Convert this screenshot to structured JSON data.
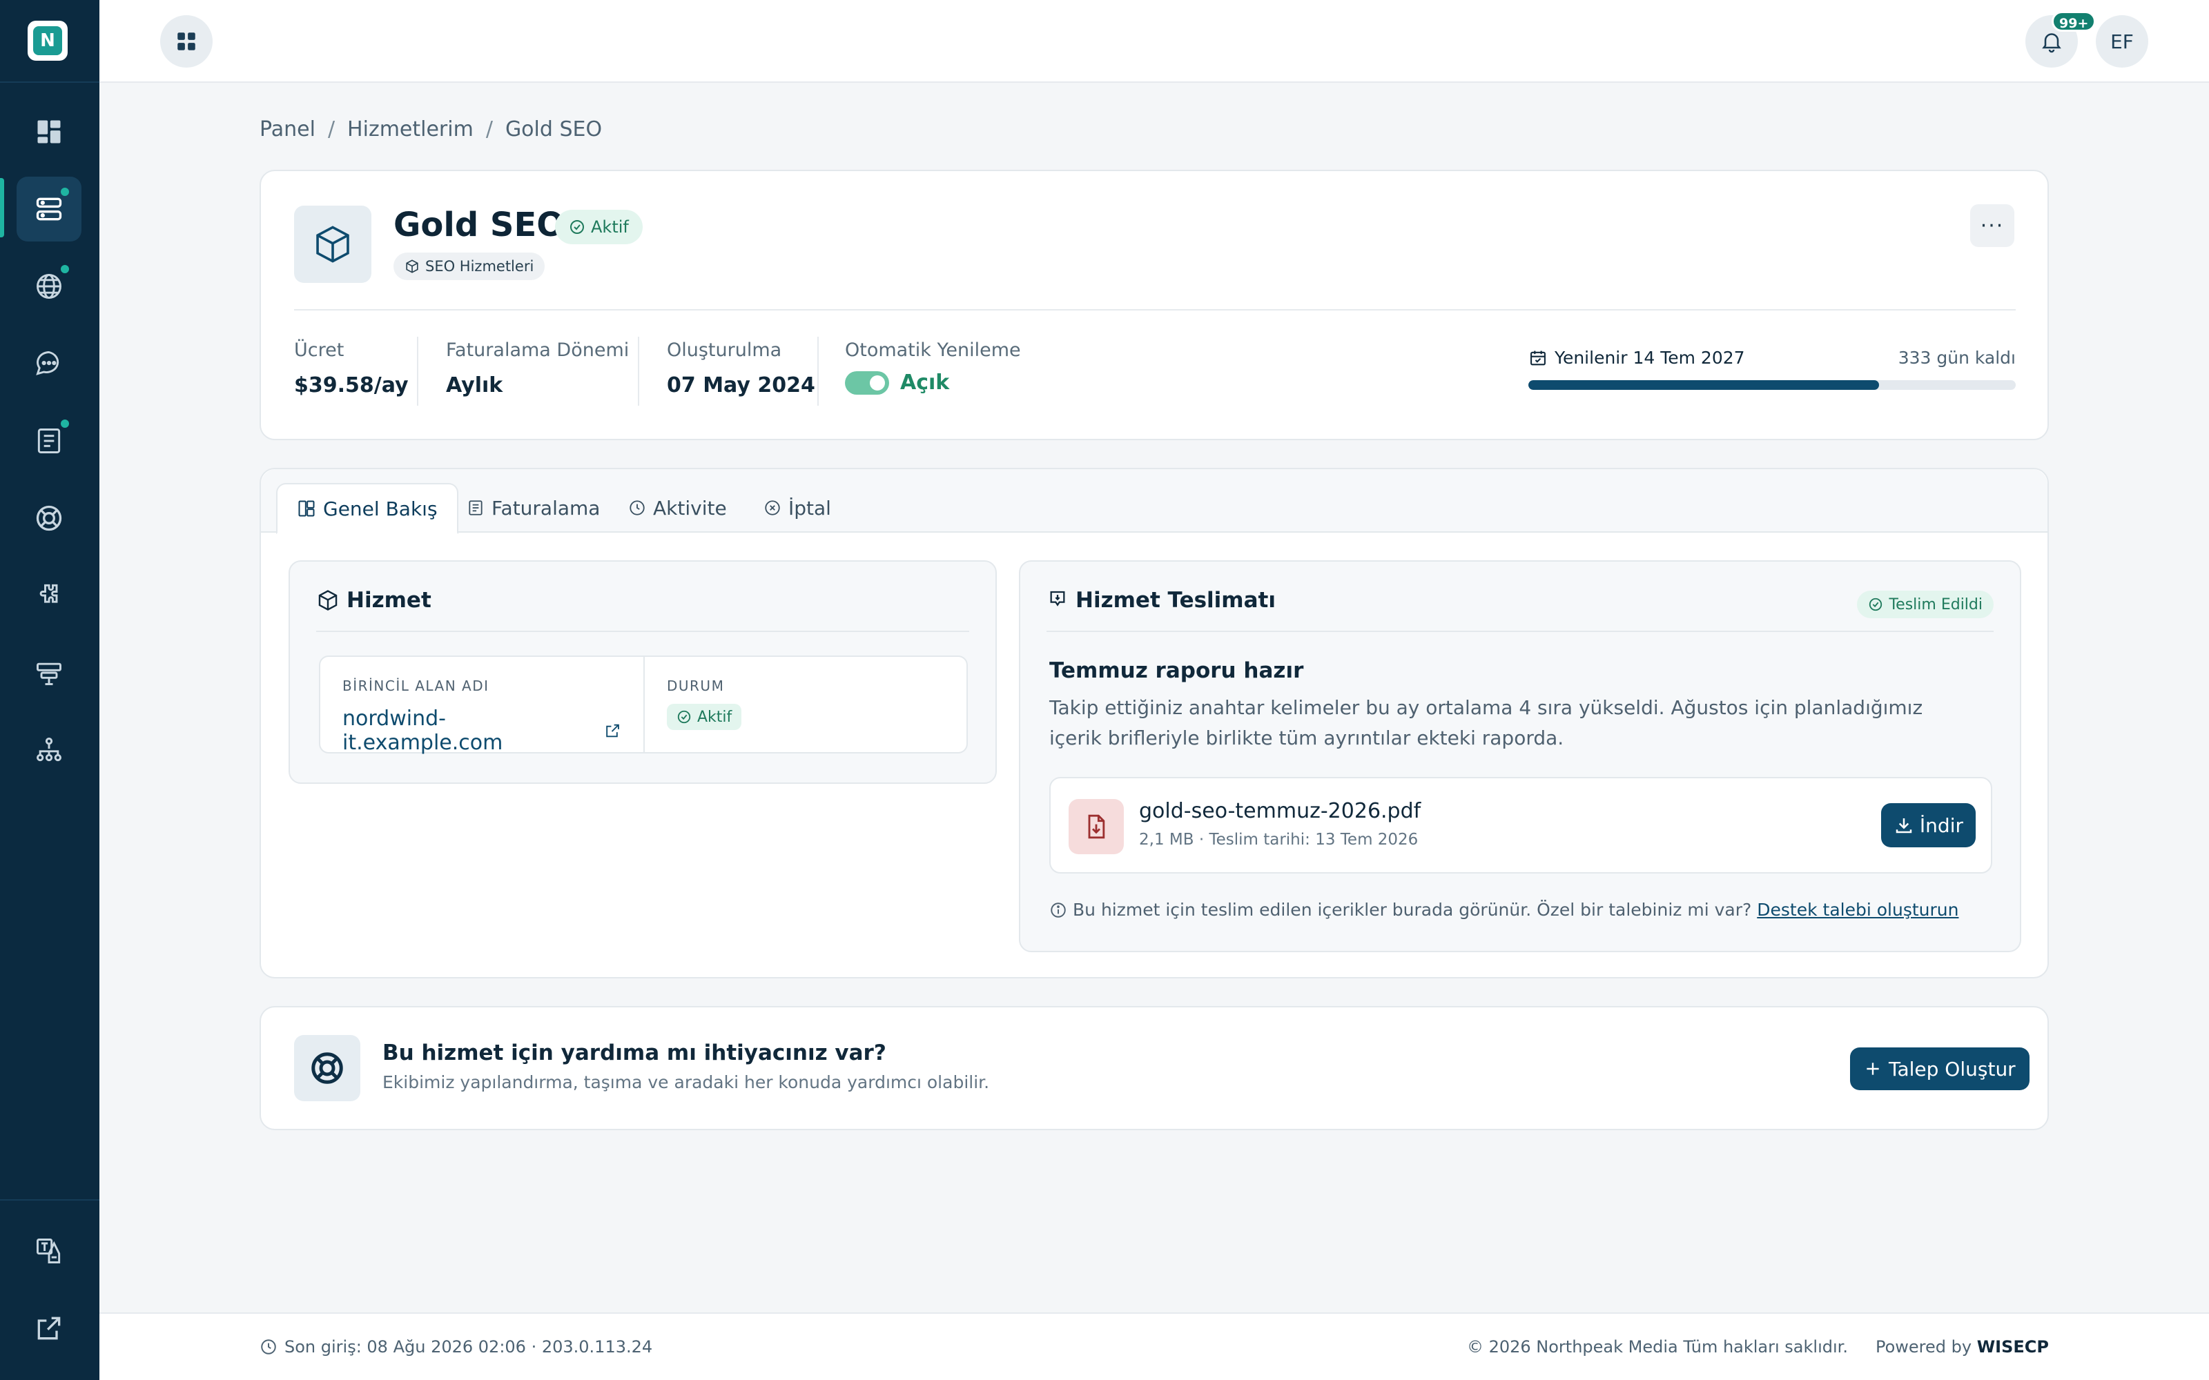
{
  "app": {
    "logo_letter": "N",
    "notifications_badge": "99+",
    "user_initials": "EF"
  },
  "breadcrumb": [
    "Panel",
    "Hizmetlerim",
    "Gold SEO"
  ],
  "service": {
    "title": "Gold SEO",
    "status": "Aktif",
    "category": "SEO Hizmetleri",
    "more_label": "···",
    "stats": [
      {
        "label": "Ücret",
        "value": "$39.58/ay"
      },
      {
        "label": "Faturalama Dönemi",
        "value": "Aylık"
      },
      {
        "label": "Oluşturulma",
        "value": "07 May 2024"
      },
      {
        "label": "Otomatik Yenileme",
        "value": "Açık"
      }
    ],
    "renewal": {
      "label": "Yenilenir 14 Tem 2027",
      "remaining": "333 gün kaldı",
      "progress_percent": 72
    }
  },
  "tabs": [
    {
      "label": "Genel Bakış",
      "icon": "layout-icon",
      "active": true
    },
    {
      "label": "Faturalama",
      "icon": "invoice-icon",
      "active": false
    },
    {
      "label": "Aktivite",
      "icon": "clock-icon",
      "active": false
    },
    {
      "label": "İptal",
      "icon": "cancel-icon",
      "active": false
    }
  ],
  "hizmet_panel": {
    "title": "Hizmet",
    "domain_label": "BİRİNCİL ALAN ADI",
    "domain_value": "nordwind-it.example.com",
    "status_label": "DURUM",
    "status_value": "Aktif"
  },
  "delivery_panel": {
    "title": "Hizmet Teslimatı",
    "badge": "Teslim Edildi",
    "report_title": "Temmuz raporu hazır",
    "report_text": "Takip ettiğiniz anahtar kelimeler bu ay ortalama 4 sıra yükseldi. Ağustos için planladığımız içerik brifleriyle birlikte tüm ayrıntılar ekteki raporda.",
    "file_name": "gold-seo-temmuz-2026.pdf",
    "file_meta": "2,1 MB · Teslim tarihi: 13 Tem 2026",
    "download_label": "İndir",
    "hint_text": "Bu hizmet için teslim edilen içerikler burada görünür. Özel bir talebiniz mi var?",
    "hint_link": "Destek talebi oluşturun"
  },
  "help": {
    "title": "Bu hizmet için yardıma mı ihtiyacınız var?",
    "subtitle": "Ekibimiz yapılandırma, taşıma ve aradaki her konuda yardımcı olabilir.",
    "button": "Talep Oluştur"
  },
  "footer": {
    "last_login": "Son giriş: 08 Ağu 2026 02:06 · 203.0.113.24",
    "copyright": "© 2026 Northpeak Media Tüm hakları saklıdır.",
    "powered_prefix": "Powered by",
    "powered_brand": "WISECP"
  },
  "colors": {
    "sidebar": "#0b2a40",
    "primary": "#0e4b6e",
    "accent": "#1fb5a2",
    "success": "#1f7a5c"
  }
}
